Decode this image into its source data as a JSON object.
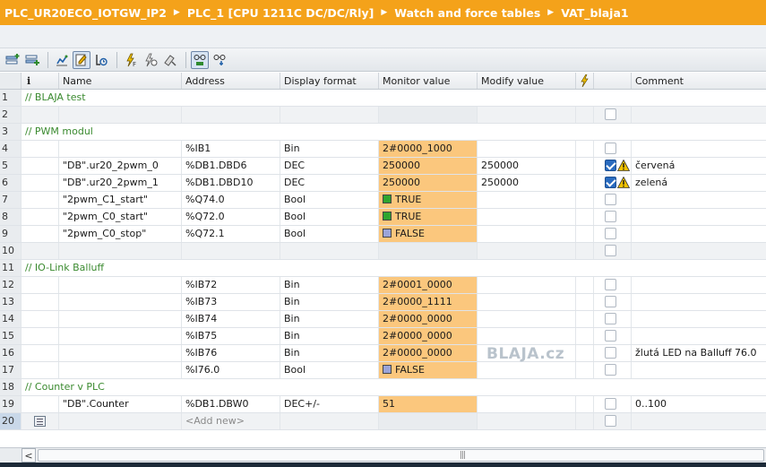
{
  "breadcrumb": [
    "PLC_UR20ECO_IOTGW_IP2",
    "PLC_1 [CPU 1211C DC/DC/Rly]",
    "Watch and force tables",
    "VAT_blaja1"
  ],
  "columns": {
    "info": "i",
    "name": "Name",
    "address": "Address",
    "display_format": "Display format",
    "monitor_value": "Monitor value",
    "modify_value": "Modify value",
    "comment": "Comment"
  },
  "rows": [
    {
      "n": "1",
      "section": "// BLAJA test"
    },
    {
      "n": "2",
      "name": "",
      "address": "",
      "format": "",
      "monitor": "",
      "modify": "",
      "checked": false,
      "warn": false,
      "comment": "",
      "gray": true
    },
    {
      "n": "3",
      "section": "// PWM modul"
    },
    {
      "n": "4",
      "name": "",
      "address": "%IB1",
      "format": "Bin",
      "monitor": "2#0000_1000",
      "modify": "",
      "checked": false,
      "warn": false,
      "comment": ""
    },
    {
      "n": "5",
      "name": "\"DB\".ur20_2pwm_0",
      "address": "%DB1.DBD6",
      "format": "DEC",
      "monitor": "250000",
      "modify": "250000",
      "checked": true,
      "warn": true,
      "comment": "červená"
    },
    {
      "n": "6",
      "name": "\"DB\".ur20_2pwm_1",
      "address": "%DB1.DBD10",
      "format": "DEC",
      "monitor": "250000",
      "modify": "250000",
      "checked": true,
      "warn": true,
      "comment": "zelená"
    },
    {
      "n": "7",
      "name": "\"2pwm_C1_start\"",
      "address": "%Q74.0",
      "format": "Bool",
      "monitor": "TRUE",
      "bool": "true",
      "modify": "",
      "checked": false,
      "warn": false,
      "comment": ""
    },
    {
      "n": "8",
      "name": "\"2pwm_C0_start\"",
      "address": "%Q72.0",
      "format": "Bool",
      "monitor": "TRUE",
      "bool": "true",
      "modify": "",
      "checked": false,
      "warn": false,
      "comment": ""
    },
    {
      "n": "9",
      "name": "\"2pwm_C0_stop\"",
      "address": "%Q72.1",
      "format": "Bool",
      "monitor": "FALSE",
      "bool": "false",
      "modify": "",
      "checked": false,
      "warn": false,
      "comment": ""
    },
    {
      "n": "10",
      "name": "",
      "address": "",
      "format": "",
      "monitor": "",
      "modify": "",
      "checked": false,
      "warn": false,
      "comment": "",
      "gray": true
    },
    {
      "n": "11",
      "section": "// IO-Link Balluff"
    },
    {
      "n": "12",
      "name": "",
      "address": "%IB72",
      "format": "Bin",
      "monitor": "2#0001_0000",
      "modify": "",
      "checked": false,
      "warn": false,
      "comment": ""
    },
    {
      "n": "13",
      "name": "",
      "address": "%IB73",
      "format": "Bin",
      "monitor": "2#0000_1111",
      "modify": "",
      "checked": false,
      "warn": false,
      "comment": ""
    },
    {
      "n": "14",
      "name": "",
      "address": "%IB74",
      "format": "Bin",
      "monitor": "2#0000_0000",
      "modify": "",
      "checked": false,
      "warn": false,
      "comment": ""
    },
    {
      "n": "15",
      "name": "",
      "address": "%IB75",
      "format": "Bin",
      "monitor": "2#0000_0000",
      "modify": "",
      "checked": false,
      "warn": false,
      "comment": ""
    },
    {
      "n": "16",
      "name": "",
      "address": "%IB76",
      "format": "Bin",
      "monitor": "2#0000_0000",
      "modify": "",
      "checked": false,
      "warn": false,
      "comment": "žlutá LED na Balluff 76.0"
    },
    {
      "n": "17",
      "name": "",
      "address": "%I76.0",
      "format": "Bool",
      "monitor": "FALSE",
      "bool": "false",
      "modify": "",
      "checked": false,
      "warn": false,
      "comment": ""
    },
    {
      "n": "18",
      "section": "// Counter v PLC"
    },
    {
      "n": "19",
      "name": "\"DB\".Counter",
      "address": "%DB1.DBW0",
      "format": "DEC+/-",
      "monitor": "51",
      "modify": "",
      "checked": false,
      "warn": false,
      "comment": "0..100"
    },
    {
      "n": "20",
      "name": "",
      "address": "<Add new>",
      "format": "",
      "monitor": "",
      "modify": "",
      "checked": false,
      "warn": false,
      "comment": "",
      "gray": true,
      "addnew": true,
      "selected": true
    }
  ],
  "watermark": "BLAJA.cz",
  "colors": {
    "breadcrumb_bg": "#f4a21a",
    "monitor_value_bg": "#fbc77d",
    "section_comment": "#3a8a2f",
    "bool_true": "#2fa52f",
    "bool_false": "#9aa4d8",
    "checkbox_on": "#2a6bbf",
    "warning": "#f2c200"
  },
  "icons": {
    "toolbar": [
      "insert-row-icon",
      "add-row-icon",
      "monitor-once-icon",
      "modify-now-icon",
      "modify-trigger-icon",
      "force-icon",
      "stop-force-icon",
      "disable-peripheral-icon",
      "show-hide-columns-icon",
      "show-advanced-icon"
    ],
    "row_warning": "warning-triangle-icon",
    "header_flag": "lightning-icon"
  }
}
